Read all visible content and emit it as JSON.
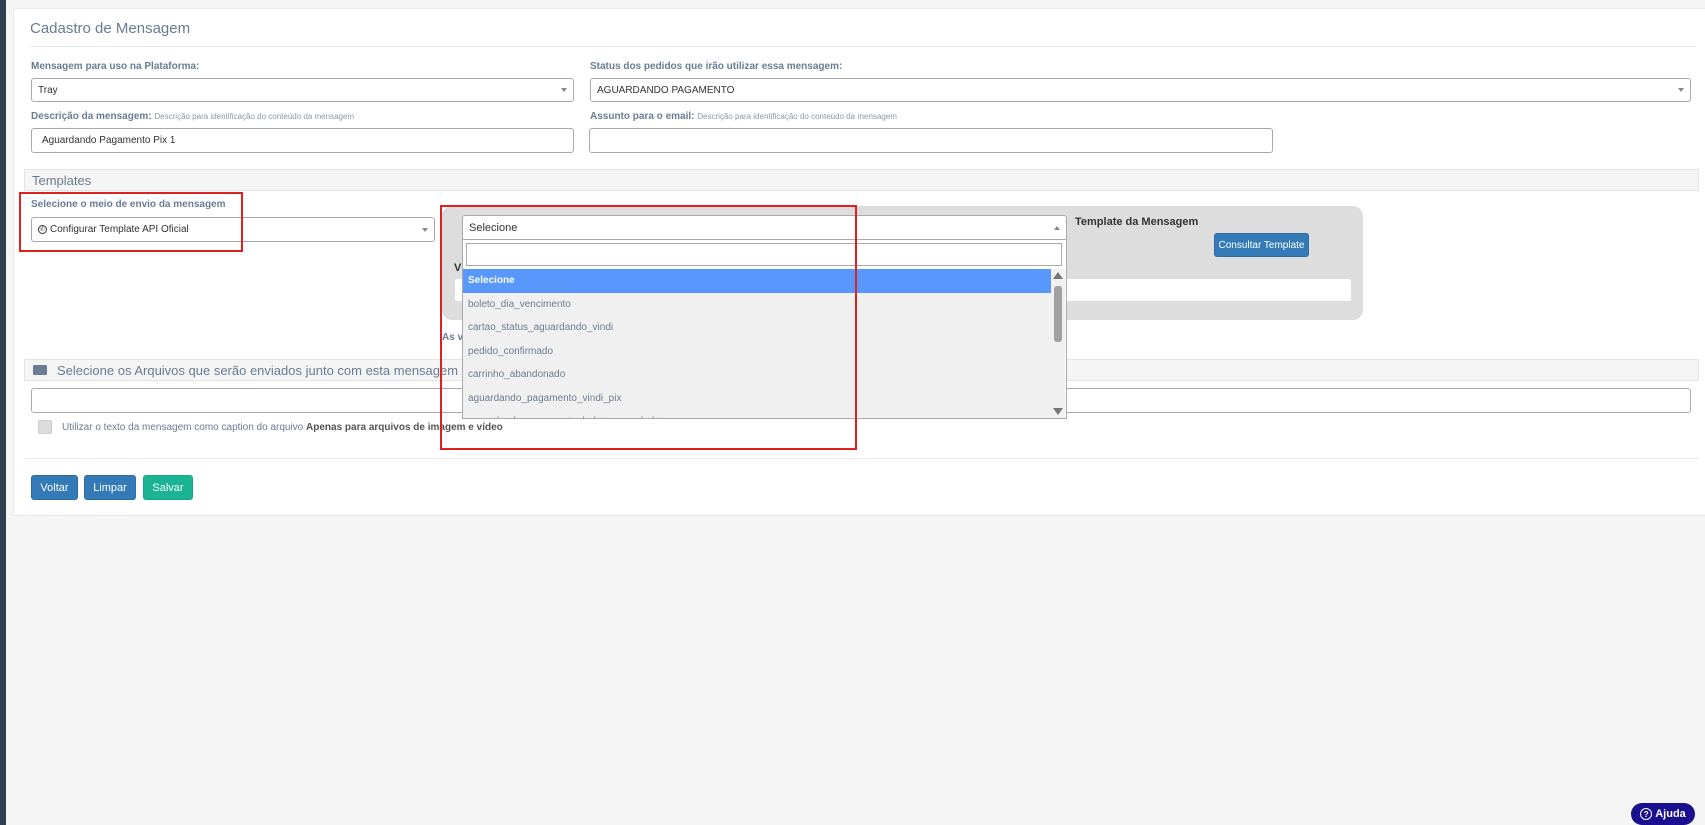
{
  "panel": {
    "title": "Cadastro de Mensagem"
  },
  "platform": {
    "label": "Mensagem para uso na Plataforma:",
    "value": "Tray"
  },
  "status": {
    "label": "Status dos pedidos que irão utilizar essa mensagem:",
    "value": "AGUARDANDO PAGAMENTO"
  },
  "description": {
    "label": "Descrição da mensagem:",
    "hint": "Descrição para identificação do conteúdo da mensagem",
    "value": "Aguardando Pagamento Pix 1"
  },
  "subject": {
    "label": "Assunto para o email:",
    "hint": "Descrição para identificação do conteúdo da mensagem",
    "value": ""
  },
  "templates": {
    "section_title": "Templates",
    "send_method_label": "Selecione o meio de envio da mensagem",
    "send_method_value": "Configurar Template API Oficial",
    "template_select_value": "Selecione",
    "template_title": "Template da Mensagem",
    "consult_button": "Consultar Template",
    "partial_v": "V",
    "partial_as": "As v"
  },
  "dropdown": {
    "options": [
      "Selecione",
      "boleto_dia_vencimento",
      "cartao_status_aguardando_vindi",
      "pedido_confirmado",
      "carrinho_abandonado",
      "aguardando_pagamento_vindi_pix",
      "aguardando_pagamento_boleto_para_boleto"
    ]
  },
  "files": {
    "section_title": "Selecione os Arquivos que serão enviados junto com esta mensagem",
    "caption_text": "Utilizar o texto da mensagem como caption do arquivo",
    "caption_bold": "Apenas para arquivos de imagem e vídeo"
  },
  "buttons": {
    "back": "Voltar",
    "clear": "Limpar",
    "save": "Salvar"
  },
  "help": {
    "label": "Ajuda"
  },
  "colors": {
    "accent": "#337ab7",
    "success": "#1ab394",
    "highlight": "#e02020",
    "option_active": "#5897fb"
  }
}
